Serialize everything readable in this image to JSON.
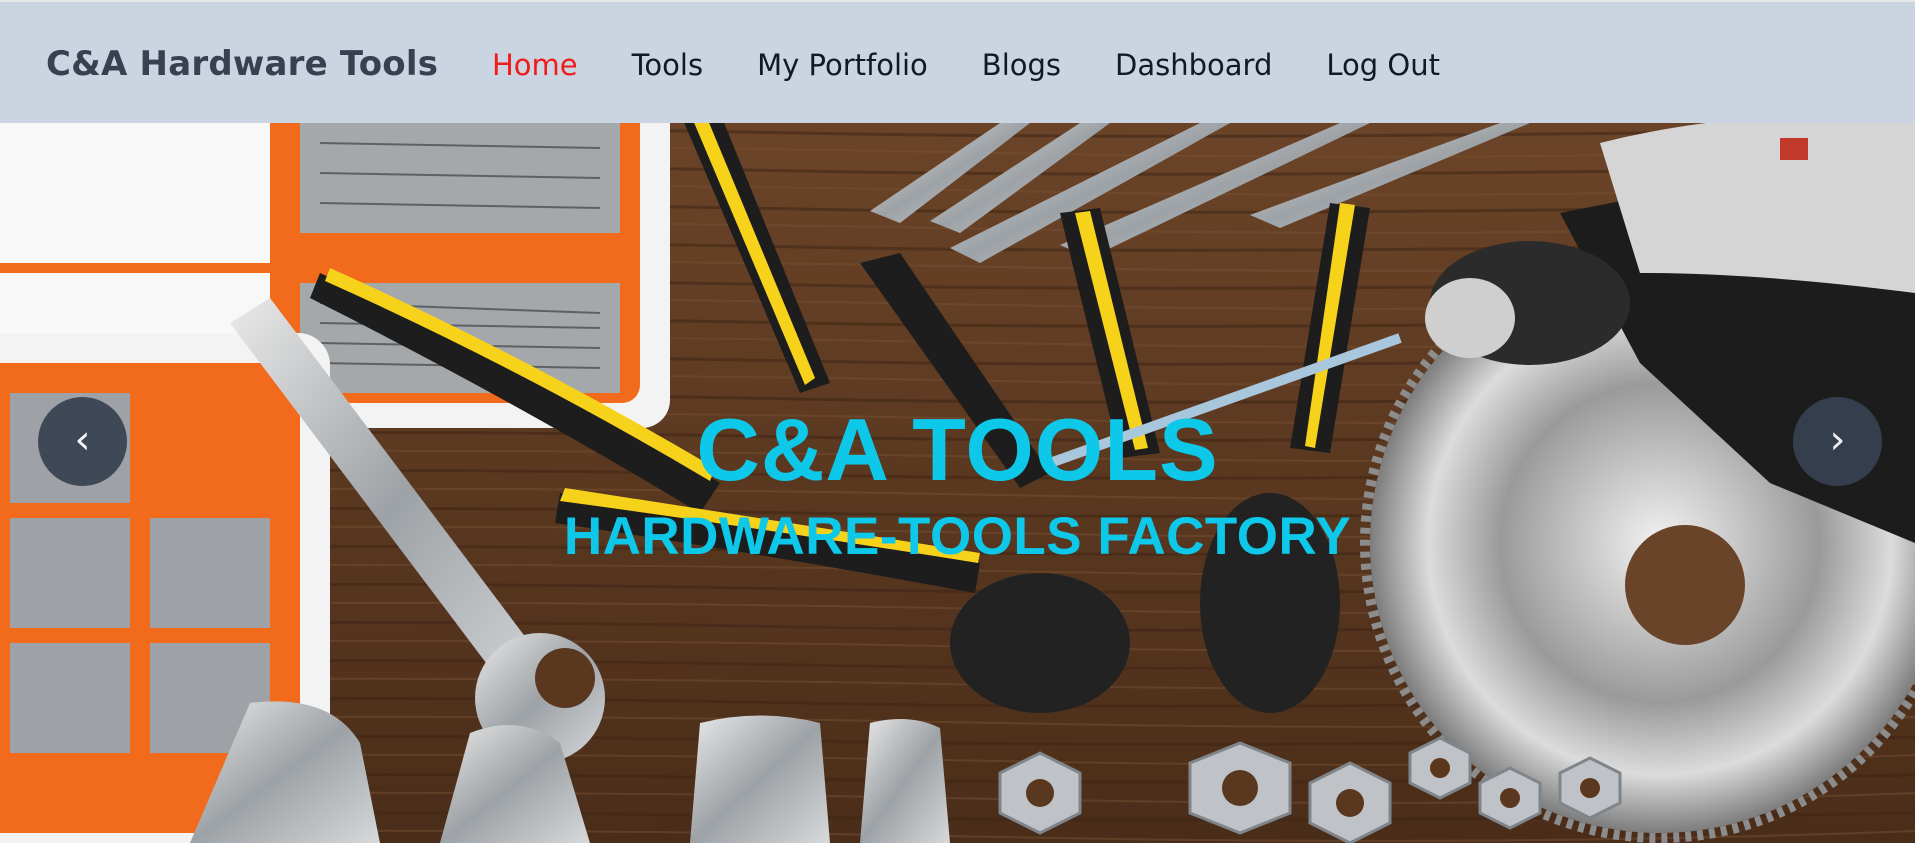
{
  "navbar": {
    "brand": "C&A Hardware Tools",
    "links": [
      {
        "label": "Home",
        "active": true
      },
      {
        "label": "Tools",
        "active": false
      },
      {
        "label": "My Portfolio",
        "active": false
      },
      {
        "label": "Blogs",
        "active": false
      },
      {
        "label": "Dashboard",
        "active": false
      },
      {
        "label": "Log Out",
        "active": false
      }
    ]
  },
  "hero": {
    "title": "C&A TOOLS",
    "subtitle": "HARDWARE-TOOLS FACTORY",
    "prev_label": "‹",
    "next_label": "›"
  },
  "colors": {
    "navbar_bg": "#cbd5e1",
    "active_link": "#ef1c1c",
    "hero_text": "#0ec8ea",
    "carousel_button": "#374151",
    "wood": "#5a3a22"
  },
  "icons": {
    "prev": "chevron-left-icon",
    "next": "chevron-right-icon"
  }
}
